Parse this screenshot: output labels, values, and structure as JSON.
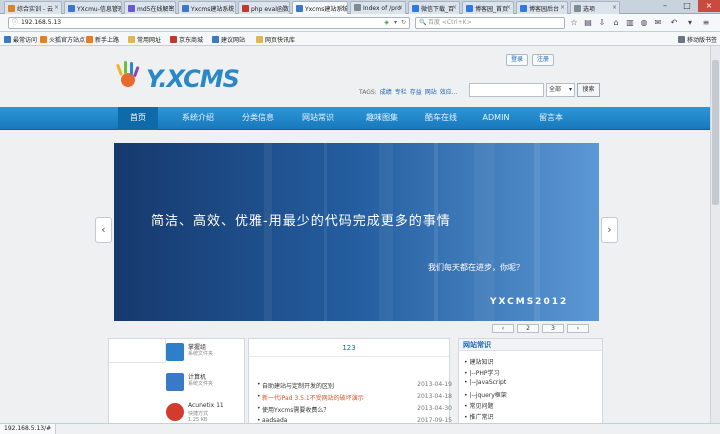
{
  "browser": {
    "tabs": [
      {
        "label": "综合实训 - 云",
        "color": "#d9822b"
      },
      {
        "label": "YXcmu-信息管理",
        "color": "#3a78c8"
      },
      {
        "label": "md5在线解密",
        "color": "#6a5acd"
      },
      {
        "label": "Yxcms建站系统",
        "color": "#3a78c8"
      },
      {
        "label": "php eval函数",
        "color": "#c0392b"
      },
      {
        "label": "Yxcms建站系统",
        "color": "#3a78c8"
      },
      {
        "label": "Index of /pro",
        "color": "#7f8c8d"
      },
      {
        "label": "微信下载_百",
        "color": "#2c7be5"
      },
      {
        "label": "博客园_首页",
        "color": "#2c7be5"
      },
      {
        "label": "博客园后台",
        "color": "#2c7be5"
      },
      {
        "label": "选项",
        "color": "#7f8c8d"
      }
    ],
    "url": "192.168.5.13",
    "search_placeholder": "百度 <Ctrl+K>",
    "bookmarks": [
      {
        "label": "最常访问",
        "color": "#3a78c8"
      },
      {
        "label": "火狐官方站点",
        "color": "#e67e22"
      },
      {
        "label": "新手上路",
        "color": "#e67e22"
      },
      {
        "label": "常用网址",
        "color": "#e0b84a"
      },
      {
        "label": "京东商城",
        "color": "#c0392b"
      },
      {
        "label": "建议网站",
        "color": "#3a78c8"
      },
      {
        "label": "网页快讯库",
        "color": "#e0b84a"
      }
    ],
    "mobile_bookmarks": "移动版书签",
    "status_url": "192.168.5.13/#"
  },
  "site": {
    "logo_text": "Y.XCMS",
    "login": "登录",
    "register": "注册",
    "tags_label": "TAGS:",
    "tags": [
      "成绩",
      "专栏",
      "存益",
      "网站",
      "效应..."
    ],
    "search_scope": "全部",
    "search_button": "搜索",
    "menu": [
      "首页",
      "系统介绍",
      "分类信息",
      "网站常识",
      "趣味图集",
      "酷车在线",
      "ADMIN",
      "留言本"
    ],
    "banner_main": "简洁、高效、优雅-用最少的代码完成更多的事情",
    "banner_sub": "我们每天都在进步，你呢？",
    "banner_brand": "YXCMS2012",
    "pager": [
      "‹",
      "2",
      "3",
      "›"
    ],
    "software": [
      {
        "name": "掌握组",
        "sub": "系统文件夹",
        "sub2": ""
      },
      {
        "name": "计算机",
        "sub": "系统文件夹",
        "sub2": ""
      },
      {
        "name": "Acunetix 11",
        "sub": "快捷方式",
        "sub2": "1.25 KB"
      }
    ],
    "news_title": "123",
    "news": [
      {
        "title": "自助建站与定制开发的区别",
        "date": "2013-04-19",
        "hl": false
      },
      {
        "title": "新一代iPad 3.5.1不受网站的破坏演示",
        "date": "2013-04-18",
        "hl": true
      },
      {
        "title": "使用Yxcms需要收费么？",
        "date": "2013-04-30",
        "hl": false
      },
      {
        "title": "aadsada",
        "date": "2017-09-15",
        "hl": false
      }
    ],
    "side_title": "网站常识",
    "side_items": [
      "建站知识",
      "|--PHP学习",
      "|--JavaScript",
      "|--jquery框架",
      "常见问题",
      "推广常识"
    ]
  }
}
